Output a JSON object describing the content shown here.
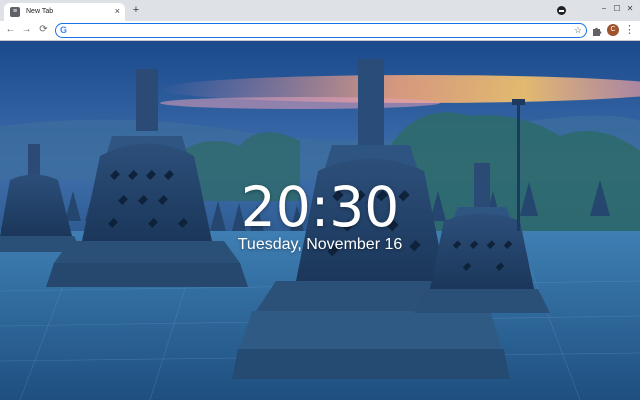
{
  "tab": {
    "title": "New Tab",
    "favicon": "page-icon",
    "close": "×"
  },
  "new_tab": {
    "label": "+"
  },
  "window_controls": {
    "minimize": "−",
    "maximize": "☐",
    "close": "✕"
  },
  "toolbar": {
    "back": "←",
    "forward": "→",
    "reload": "⟳"
  },
  "omnibox": {
    "value": "",
    "placeholder": "",
    "icon": "google-g-icon",
    "star": "☆"
  },
  "profile": {
    "initial": "C"
  },
  "menu": {
    "label": "⋮"
  },
  "newtab": {
    "time": "20:30",
    "date": "Tuesday, November 16"
  },
  "colors": {
    "accent": "#1a73e8",
    "tabstrip": "#dee1e6",
    "avatar": "#a0522d"
  }
}
